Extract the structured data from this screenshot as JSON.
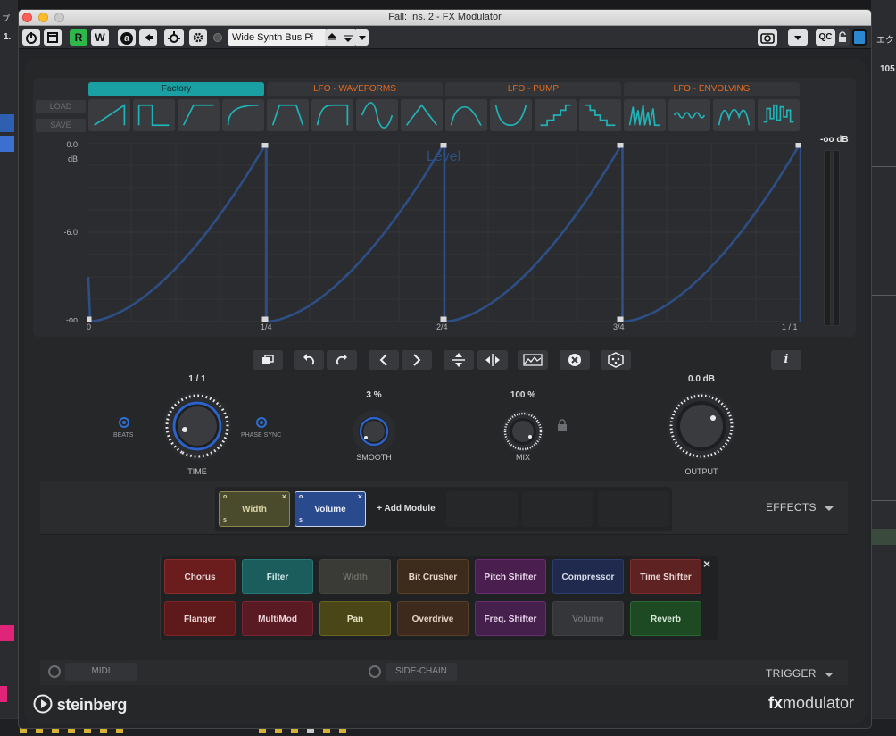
{
  "window": {
    "title": "Fall: Ins. 2 - FX Modulator",
    "preset_name": "Wide Synth Bus Pi",
    "toolbar": {
      "r_label": "R",
      "w_label": "W",
      "qc_label": "QC",
      "a_label": "a"
    }
  },
  "background": {
    "left_glyph": "1.",
    "right_top": "エク",
    "right_num": "105",
    "left_glyph2": "プ"
  },
  "categories": [
    {
      "label": "Factory",
      "active": true
    },
    {
      "label": "LFO - WAVEFORMS"
    },
    {
      "label": "LFO - PUMP"
    },
    {
      "label": "LFO - ENVOLVING"
    }
  ],
  "side_buttons": {
    "load": "LOAD",
    "save": "SAVE"
  },
  "shapes": [
    "saw-up-icon",
    "square-icon",
    "ramp-hold-icon",
    "exp-rise-icon",
    "trapezoid-icon",
    "trapezoid-soft-icon",
    "sine-icon",
    "triangle-icon",
    "hump-icon",
    "valley-icon",
    "stairs-icon",
    "stairs-down-icon",
    "burst-icon",
    "noise-wave-icon",
    "bumps-icon",
    "random-steps-icon"
  ],
  "graph": {
    "overlay_label": "Level",
    "y_labels": [
      "0.0",
      "dB",
      "-6.0",
      "-oo"
    ],
    "x_labels": [
      "0",
      "1/4",
      "2/4",
      "3/4",
      "1 / 1"
    ],
    "line_color": "#2d4f86",
    "grid_color": "#3a3b3e"
  },
  "meter": {
    "label": "-oo dB"
  },
  "controls": [
    "copy-icon",
    "undo-icon",
    "redo-icon",
    "prev-icon",
    "next-icon",
    "flip-vertical-icon",
    "flip-horizontal-icon",
    "waveform-icon",
    "clear-icon",
    "dice-icon"
  ],
  "info_label": "i",
  "knobs": {
    "time": {
      "value": "1 / 1",
      "label": "TIME"
    },
    "smooth": {
      "value": "3 %",
      "label": "SMOOTH"
    },
    "mix": {
      "value": "100 %",
      "label": "MIX"
    },
    "output": {
      "value": "0.0 dB",
      "label": "OUTPUT"
    },
    "beats_label": "BEATS",
    "phase_sync_label": "PHASE SYNC"
  },
  "modules": [
    {
      "label": "Width",
      "s_top": "o",
      "s_bottom": "s",
      "close": "×"
    },
    {
      "label": "Volume",
      "s_top": "o",
      "s_bottom": "s",
      "close": "×"
    }
  ],
  "add_module_label": "+ Add Module",
  "effects_label": "EFFECTS",
  "effects": [
    {
      "label": "Chorus",
      "bg": "#6b1d1d",
      "fg": "#e8d6d6",
      "border": "#8a2c2c"
    },
    {
      "label": "Filter",
      "bg": "#1b5c5c",
      "fg": "#d5ecec",
      "border": "#2a7878"
    },
    {
      "label": "Width",
      "bg": "#3a3a36",
      "fg": "#6c6c66",
      "border": "#44443f"
    },
    {
      "label": "Bit Crusher",
      "bg": "#3d2b1c",
      "fg": "#e4d6c8",
      "border": "#5a4028"
    },
    {
      "label": "Pitch Shifter",
      "bg": "#4a1f4f",
      "fg": "#ebd8ec",
      "border": "#6a2d70"
    },
    {
      "label": "Compressor",
      "bg": "#1f2a4e",
      "fg": "#d8ddec",
      "border": "#2e3c6d"
    },
    {
      "label": "Time Shifter",
      "bg": "#5e2222",
      "fg": "#ecd6d6",
      "border": "#7d2f2f"
    },
    {
      "label": "Flanger",
      "bg": "#5e1a1a",
      "fg": "#ead4d4",
      "border": "#7b2626"
    },
    {
      "label": "MultiMod",
      "bg": "#5a1a24",
      "fg": "#eed4d8",
      "border": "#782633"
    },
    {
      "label": "Pan",
      "bg": "#4a4618",
      "fg": "#e9e6c8",
      "border": "#6a6424"
    },
    {
      "label": "Overdrive",
      "bg": "#3d2a1c",
      "fg": "#e6d5c6",
      "border": "#574028"
    },
    {
      "label": "Freq. Shifter",
      "bg": "#45204c",
      "fg": "#ead6ed",
      "border": "#652e6d"
    },
    {
      "label": "Volume",
      "bg": "#35363a",
      "fg": "#6d6f73",
      "border": "#404145"
    },
    {
      "label": "Reverb",
      "bg": "#1d4a22",
      "fg": "#d6ead8",
      "border": "#2b6a32"
    }
  ],
  "effects_close": "×",
  "bottom": {
    "midi_label": "MIDI",
    "sidechain_label": "SIDE-CHAIN",
    "trigger_label": "TRIGGER"
  },
  "footer": {
    "brand": "steinberg",
    "product_fx": "fx",
    "product_name": "modulator"
  }
}
